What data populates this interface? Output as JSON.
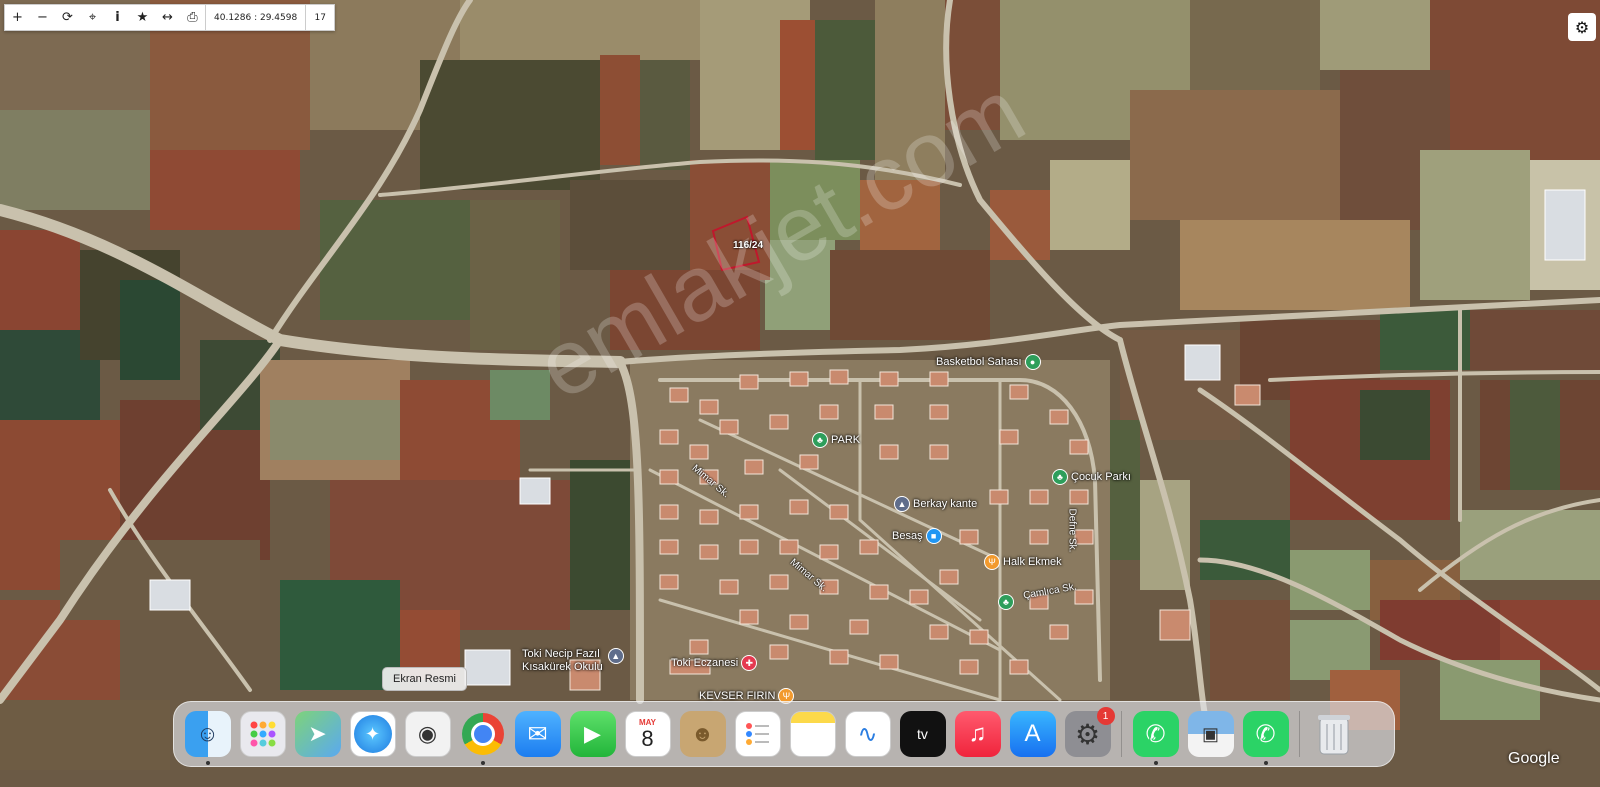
{
  "toolbar": {
    "zoom_in": "+",
    "zoom_out": "−",
    "refresh": "⟳",
    "locate": "⌖",
    "info": "i",
    "favorite": "★",
    "measure": "↔",
    "print": "⎙",
    "coordinates": "40.1286 : 29.4598",
    "zoom_level": "17"
  },
  "settings_icon": "⚙",
  "parcel": {
    "label": "116/24",
    "outline_color": "#c0182c"
  },
  "watermark": "emlakjet.com",
  "pois": [
    {
      "name": "Basketbol Sahası",
      "icon": "basketball-court-pin",
      "color": "#2e9e5b"
    },
    {
      "name": "PARK",
      "icon": "park-tree-pin",
      "color": "#2e9e5b"
    },
    {
      "name": "Çocuk Parkı",
      "icon": "playground-pin",
      "color": "#2e9e5b"
    },
    {
      "name": "Berkay kante",
      "icon": "school-pin",
      "color": "#5f6d8b"
    },
    {
      "name": "Besaş",
      "icon": "shopping-pin",
      "color": "#2196f3"
    },
    {
      "name": "Halk Ekmek",
      "icon": "restaurant-pin",
      "color": "#f29a2e"
    },
    {
      "name": "",
      "icon": "tree-pin",
      "color": "#2e9e5b"
    },
    {
      "name": "Toki Necip Fazıl\nKısakürek Okulu",
      "icon": "school-pin",
      "color": "#5f6d8b"
    },
    {
      "name": "Toki Eczanesi",
      "icon": "pharmacy-pin",
      "color": "#e53950"
    },
    {
      "name": "KEVSER FIRIN",
      "icon": "bakery-pin",
      "color": "#f29a2e"
    }
  ],
  "streets": [
    "Mimar Sk.",
    "Mimar Sk.",
    "Defne Sk.",
    "Çamlıca Sk."
  ],
  "tooltip": "Ekran Resmi",
  "dock": {
    "apps": [
      {
        "name": "Finder",
        "icon": "finder-icon",
        "running": true
      },
      {
        "name": "Launchpad",
        "icon": "launchpad-icon",
        "running": false
      },
      {
        "name": "Maps",
        "icon": "maps-icon",
        "running": false
      },
      {
        "name": "Safari",
        "icon": "safari-icon",
        "running": false
      },
      {
        "name": "Screenshot",
        "icon": "screenshot-icon",
        "running": false
      },
      {
        "name": "Chrome",
        "icon": "chrome-icon",
        "running": true
      },
      {
        "name": "Mail",
        "icon": "mail-icon",
        "running": false
      },
      {
        "name": "FaceTime",
        "icon": "facetime-icon",
        "running": false
      },
      {
        "name": "Calendar",
        "icon": "calendar-icon",
        "running": false,
        "month": "MAY",
        "day": "8"
      },
      {
        "name": "Contacts",
        "icon": "contacts-icon",
        "running": false
      },
      {
        "name": "Reminders",
        "icon": "reminders-icon",
        "running": false
      },
      {
        "name": "Notes",
        "icon": "notes-icon",
        "running": false
      },
      {
        "name": "Freeform",
        "icon": "freeform-icon",
        "running": false
      },
      {
        "name": "Apple TV",
        "icon": "appletv-icon",
        "running": false,
        "label": "tv"
      },
      {
        "name": "Music",
        "icon": "music-icon",
        "running": false
      },
      {
        "name": "App Store",
        "icon": "appstore-icon",
        "running": false
      },
      {
        "name": "System Settings",
        "icon": "settings-icon",
        "running": false,
        "badge": "1"
      }
    ],
    "recent": [
      {
        "name": "WhatsApp",
        "icon": "whatsapp-icon",
        "running": true
      },
      {
        "name": "Preview",
        "icon": "preview-icon",
        "running": false
      },
      {
        "name": "WhatsApp Business",
        "icon": "whatsapp-business-icon",
        "running": true
      }
    ],
    "trash": {
      "name": "Trash",
      "icon": "trash-icon"
    }
  },
  "attribution": "Google"
}
